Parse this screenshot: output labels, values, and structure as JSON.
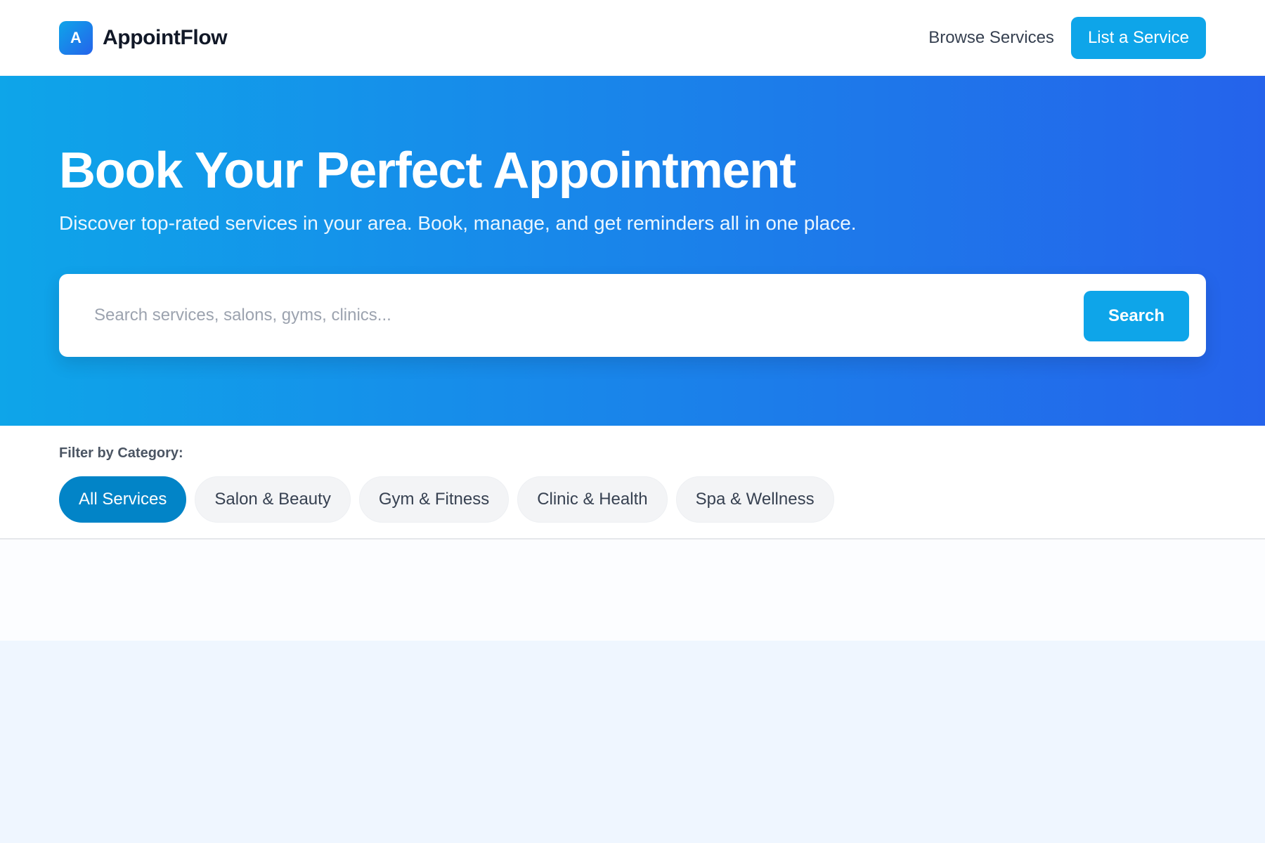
{
  "header": {
    "logo_letter": "A",
    "brand_name": "AppointFlow",
    "nav": {
      "browse_label": "Browse Services",
      "cta_label": "List a Service"
    }
  },
  "hero": {
    "title": "Book Your Perfect Appointment",
    "subtitle": "Discover top-rated services in your area. Book, manage, and get reminders all in one place.",
    "search": {
      "placeholder": "Search services, salons, gyms, clinics...",
      "value": "",
      "button_label": "Search"
    }
  },
  "filters": {
    "label": "Filter by Category:",
    "categories": [
      {
        "label": "All Services",
        "active": true
      },
      {
        "label": "Salon & Beauty",
        "active": false
      },
      {
        "label": "Gym & Fitness",
        "active": false
      },
      {
        "label": "Clinic & Health",
        "active": false
      },
      {
        "label": "Spa & Wellness",
        "active": false
      }
    ]
  },
  "colors": {
    "accent": "#0ea5e9",
    "active_chip": "#0284c7",
    "hero_gradient_start": "#0ea5e9",
    "hero_gradient_end": "#2563eb"
  }
}
